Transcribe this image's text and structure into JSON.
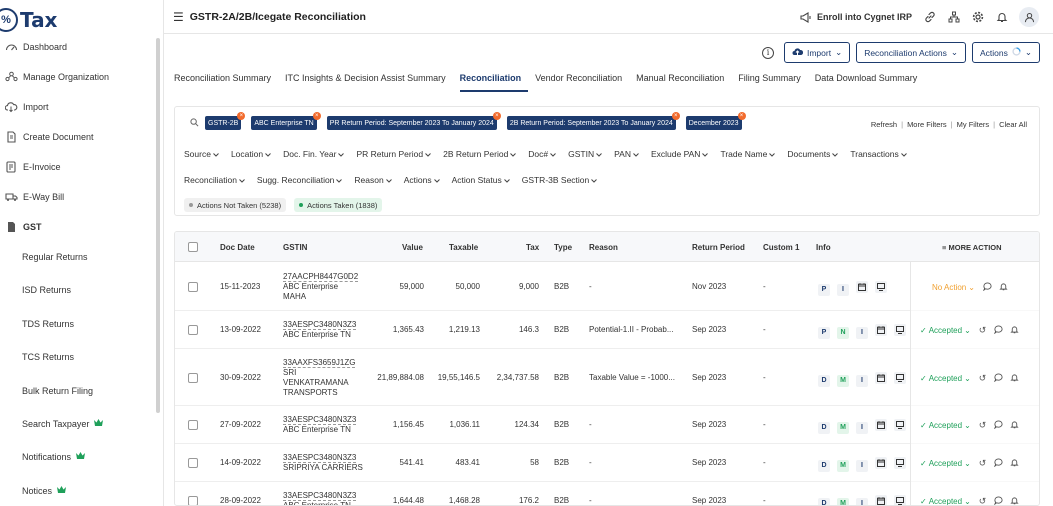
{
  "logo": {
    "symbol": "%",
    "text": "Tax"
  },
  "header": {
    "title": "GSTR-2A/2B/Icegate Reconciliation",
    "enroll_label": "Enroll into Cygnet IRP"
  },
  "sidebar": {
    "items": [
      {
        "label": "Dashboard",
        "icon": "gauge-icon"
      },
      {
        "label": "Manage Organization",
        "icon": "org-icon"
      },
      {
        "label": "Import",
        "icon": "import-icon"
      },
      {
        "label": "Create Document",
        "icon": "document-icon"
      },
      {
        "label": "E-Invoice",
        "icon": "invoice-icon"
      },
      {
        "label": "E-Way Bill",
        "icon": "truck-icon"
      },
      {
        "label": "GST",
        "icon": "gst-icon"
      }
    ],
    "sub_items": [
      {
        "label": "Regular Returns",
        "crown": false
      },
      {
        "label": "ISD Returns",
        "crown": false
      },
      {
        "label": "TDS Returns",
        "crown": false
      },
      {
        "label": "TCS Returns",
        "crown": false
      },
      {
        "label": "Bulk Return Filing",
        "crown": false
      },
      {
        "label": "Search Taxpayer",
        "crown": true
      },
      {
        "label": "Notifications",
        "crown": true
      },
      {
        "label": "Notices",
        "crown": true
      }
    ]
  },
  "toolbar": {
    "import_label": "Import",
    "recon_actions_label": "Reconciliation Actions",
    "actions_label": "Actions"
  },
  "tabs": [
    {
      "label": "Reconciliation Summary",
      "active": false
    },
    {
      "label": "ITC Insights & Decision Assist Summary",
      "active": false
    },
    {
      "label": "Reconciliation",
      "active": true
    },
    {
      "label": "Vendor Reconciliation",
      "active": false
    },
    {
      "label": "Manual Reconciliation",
      "active": false
    },
    {
      "label": "Filing Summary",
      "active": false
    },
    {
      "label": "Data Download Summary",
      "active": false
    }
  ],
  "filters": {
    "chips": [
      "GSTR-2B",
      "ABC Enterprise TN",
      "PR Return Period: September 2023 To January 2024",
      "2B Return Period: September 2023 To January 2024",
      "December 2023"
    ],
    "links": [
      "Refresh",
      "More Filters",
      "My Filters",
      "Clear All"
    ],
    "row1": [
      "Source",
      "Location",
      "Doc. Fin. Year",
      "PR Return Period",
      "2B Return Period",
      "Doc#",
      "GSTIN",
      "PAN",
      "Exclude PAN",
      "Trade Name",
      "Documents",
      "Transactions"
    ],
    "row2": [
      "Reconciliation",
      "Sugg. Reconciliation",
      "Reason",
      "Actions",
      "Action Status",
      "GSTR-3B Section"
    ],
    "action_chips": [
      {
        "label": "Actions Not Taken (5238)",
        "color": "#999999",
        "bg": "#f0f0f0"
      },
      {
        "label": "Actions Taken (1838)",
        "color": "#1fa05a",
        "bg": "#e3f5ea"
      }
    ]
  },
  "table": {
    "headers": {
      "doc_date": "Doc Date",
      "gstin": "GSTIN",
      "value": "Value",
      "taxable": "Taxable",
      "tax": "Tax",
      "type": "Type",
      "reason": "Reason",
      "return_period": "Return Period",
      "custom1": "Custom 1",
      "info": "Info",
      "more": "MORE ACTION"
    },
    "rows": [
      {
        "date": "15-11-2023",
        "gstin": "27AACPH8447G0D2",
        "name1": "ABC Enterprise",
        "name2": "MAHA",
        "name3": "",
        "value": "59,000",
        "taxable": "50,000",
        "tax": "9,000",
        "type": "B2B",
        "reason": "-",
        "period": "Nov 2023",
        "custom": "-",
        "badges": [
          "P",
          "I"
        ],
        "status": "No Action"
      },
      {
        "date": "13-09-2022",
        "gstin": "33AESPC3480N3Z3",
        "name1": "ABC Enterprise TN",
        "name2": "",
        "name3": "",
        "value": "1,365.43",
        "taxable": "1,219.13",
        "tax": "146.3",
        "type": "B2B",
        "reason": "Potential-1.II - Probab...",
        "period": "Sep 2023",
        "custom": "-",
        "badges": [
          "P",
          "N",
          "I"
        ],
        "status": "Accepted"
      },
      {
        "date": "30-09-2022",
        "gstin": "33AAXFS3659J1ZG",
        "name1": "SRI",
        "name2": "VENKATRAMANA",
        "name3": "TRANSPORTS",
        "value": "21,89,884.08",
        "taxable": "19,55,146.5",
        "tax": "2,34,737.58",
        "type": "B2B",
        "reason": "Taxable Value = -1000...",
        "period": "Sep 2023",
        "custom": "-",
        "badges": [
          "D",
          "M",
          "I"
        ],
        "status": "Accepted"
      },
      {
        "date": "27-09-2022",
        "gstin": "33AESPC3480N3Z3",
        "name1": "ABC Enterprise TN",
        "name2": "",
        "name3": "",
        "value": "1,156.45",
        "taxable": "1,036.11",
        "tax": "124.34",
        "type": "B2B",
        "reason": "-",
        "period": "Sep 2023",
        "custom": "-",
        "badges": [
          "D",
          "M",
          "I"
        ],
        "status": "Accepted"
      },
      {
        "date": "14-09-2022",
        "gstin": "33AESPC3480N3Z3",
        "name1": "SRIPRIYA CARRIERS",
        "name2": "",
        "name3": "",
        "value": "541.41",
        "taxable": "483.41",
        "tax": "58",
        "type": "B2B",
        "reason": "-",
        "period": "Sep 2023",
        "custom": "-",
        "badges": [
          "D",
          "M",
          "I"
        ],
        "status": "Accepted"
      },
      {
        "date": "28-09-2022",
        "gstin": "33AESPC3480N3Z3",
        "name1": "ABC Enterprise TN",
        "name2": "",
        "name3": "",
        "value": "1,644.48",
        "taxable": "1,468.28",
        "tax": "176.2",
        "type": "B2B",
        "reason": "-",
        "period": "Sep 2023",
        "custom": "-",
        "badges": [
          "D",
          "M",
          "I"
        ],
        "status": "Accepted"
      }
    ]
  },
  "colors": {
    "brand": "#1d3b6e",
    "accent_orange": "#f26b2d",
    "accepted": "#1fa05a",
    "no_action": "#f0a030"
  }
}
